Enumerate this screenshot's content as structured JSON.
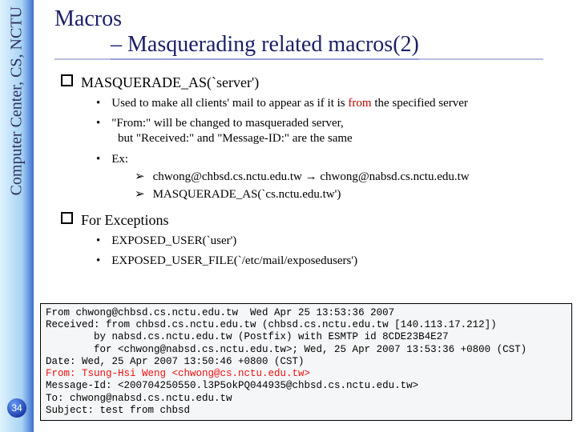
{
  "sidebar": {
    "label": "Computer Center, CS, NCTU"
  },
  "page_number": "34",
  "title": {
    "line1": "Macros",
    "line2": "– Masquerading related macros(2)"
  },
  "section1": {
    "heading": "MASQUERADE_AS(`server')",
    "b1_pre": "Used to make all clients' mail to appear as if it is ",
    "b1_from": "from",
    "b1_post": " the specified server",
    "b2_line1": "\"From:\" will be changed to masqueraded server,",
    "b2_line2": "but \"Received:\" and \"Message-ID:\" are the same",
    "b3": "Ex:",
    "ex1": "chwong@chbsd.cs.nctu.edu.tw → chwong@nabsd.cs.nctu.edu.tw",
    "ex2": "MASQUERADE_AS(`cs.nctu.edu.tw')"
  },
  "section2": {
    "heading": "For Exceptions",
    "b1": "EXPOSED_USER(`user')",
    "b2": "EXPOSED_USER_FILE(`/etc/mail/exposedusers')"
  },
  "mail": {
    "l1": "From chwong@chbsd.cs.nctu.edu.tw  Wed Apr 25 13:53:36 2007",
    "l2": "Received: from chbsd.cs.nctu.edu.tw (chbsd.cs.nctu.edu.tw [140.113.17.212])",
    "l3": "        by nabsd.cs.nctu.edu.tw (Postfix) with ESMTP id 8CDE23B4E27",
    "l4": "        for <chwong@nabsd.cs.nctu.edu.tw>; Wed, 25 Apr 2007 13:53:36 +0800 (CST)",
    "l5": "Date: Wed, 25 Apr 2007 13:50:46 +0800 (CST)",
    "l6": "From: Tsung-Hsi Weng <chwong@cs.nctu.edu.tw>",
    "l7": "Message-Id: <200704250550.l3P5okPQ044935@chbsd.cs.nctu.edu.tw>",
    "l8": "To: chwong@nabsd.cs.nctu.edu.tw",
    "l9": "Subject: test from chbsd"
  }
}
